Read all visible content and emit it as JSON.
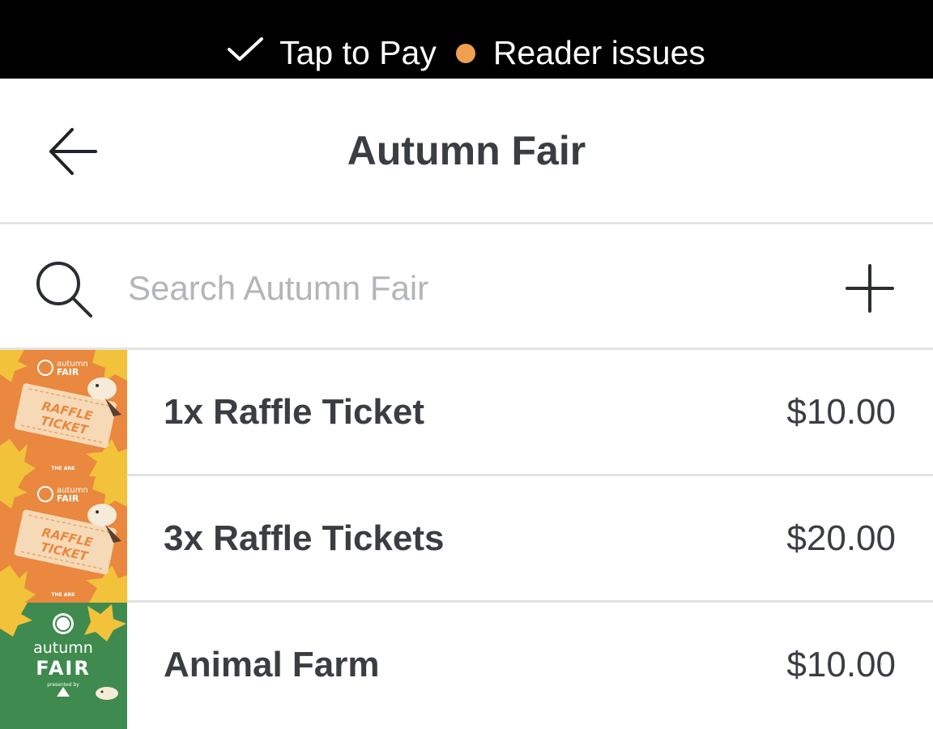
{
  "status_bar": {
    "tap_to_pay_label": "Tap to Pay",
    "reader_label": "Reader issues",
    "reader_status_color": "#f0a050"
  },
  "header": {
    "title": "Autumn Fair",
    "back_icon": "arrow-left-icon"
  },
  "search": {
    "placeholder": "Search Autumn Fair",
    "value": "",
    "icon": "search-icon",
    "add_icon": "plus-icon"
  },
  "items": [
    {
      "name": "1x Raffle Ticket",
      "price": "$10.00",
      "thumb": {
        "variant": "raffle",
        "bg": "#e9883e",
        "line1": "RAFFLE",
        "line2": "TICKET",
        "brand": "autumn",
        "brand2": "FAIR",
        "org": "THE ARK"
      }
    },
    {
      "name": "3x Raffle Tickets",
      "price": "$20.00",
      "thumb": {
        "variant": "raffle",
        "bg": "#e9883e",
        "line1": "RAFFLE",
        "line2": "TICKET",
        "brand": "autumn",
        "brand2": "FAIR",
        "org": "THE ARK"
      }
    },
    {
      "name": "Animal Farm",
      "price": "$10.00",
      "thumb": {
        "variant": "fair",
        "bg": "#3f8a4e",
        "brand": "autumn",
        "brand2": "FAIR",
        "presented": "presented by"
      }
    }
  ]
}
